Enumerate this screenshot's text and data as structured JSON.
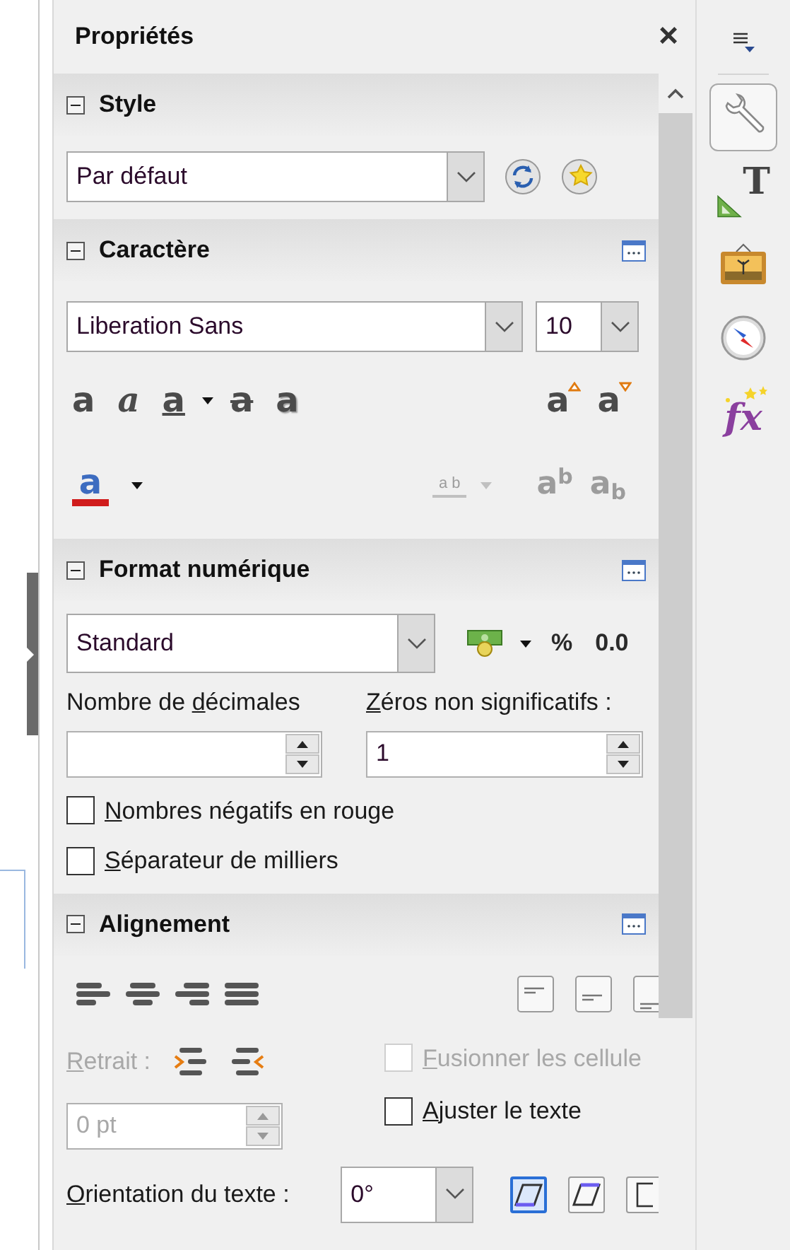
{
  "panel": {
    "title": "Propriétés",
    "close": "×"
  },
  "style_section": {
    "title": "Style",
    "expanded": true,
    "value": "Par défaut"
  },
  "character_section": {
    "title": "Caractère",
    "expanded": true,
    "font": "Liberation Sans",
    "size": "10",
    "format_buttons": [
      {
        "kind": "bold",
        "glyph": "a",
        "disabled": false
      },
      {
        "kind": "italic",
        "glyph": "a",
        "disabled": false
      },
      {
        "kind": "underline",
        "glyph": "a",
        "disabled": false
      },
      {
        "kind": "strike",
        "glyph": "a",
        "disabled": false
      },
      {
        "kind": "shadow",
        "glyph": "a",
        "disabled": false
      }
    ],
    "size_buttons": [
      {
        "kind": "grow",
        "glyph": "a",
        "disabled": false
      },
      {
        "kind": "shrink",
        "glyph": "a",
        "disabled": false
      }
    ],
    "color_button": {
      "glyph": "a",
      "color": "#d01c1c"
    },
    "spacing_button": {
      "glyph": "a b",
      "disabled": true
    },
    "script_buttons": [
      {
        "kind": "superscript",
        "glyph": "a",
        "mark": "b",
        "disabled": true
      },
      {
        "kind": "subscript",
        "glyph": "a",
        "mark": "b",
        "disabled": true
      }
    ]
  },
  "number_section": {
    "title": "Format numérique",
    "expanded": true,
    "format": "Standard",
    "buttons": [
      {
        "kind": "currency"
      },
      {
        "kind": "text",
        "glyph": "%"
      },
      {
        "kind": "text",
        "glyph": "0.0"
      }
    ],
    "decimals_label": {
      "pre": "Nombre de ",
      "key": "d",
      "post": "écimales"
    },
    "zeros_label": {
      "key": "Z",
      "post": "éros non significatifs :"
    },
    "zeros_value": "1",
    "checkboxes": [
      {
        "label": {
          "key": "N",
          "post": "ombres négatifs en rouge"
        },
        "checked": false,
        "disabled": false
      },
      {
        "label": {
          "key": "S",
          "post": "éparateur de milliers"
        },
        "checked": false,
        "disabled": false
      }
    ]
  },
  "alignment_section": {
    "title": "Alignement",
    "expanded": true,
    "horizontal": [
      {
        "kind": "left"
      },
      {
        "kind": "center"
      },
      {
        "kind": "right"
      },
      {
        "kind": "justify"
      }
    ],
    "vertical": [
      {
        "kind": "top"
      },
      {
        "kind": "middle"
      },
      {
        "kind": "bottom"
      }
    ],
    "indent_label": {
      "key": "R",
      "post": "etrait :"
    },
    "indent_disabled": true,
    "indent_value": "0 pt",
    "checkboxes": [
      {
        "label": {
          "key": "F",
          "post": "usionner les cellule"
        },
        "checked": false,
        "disabled": true
      },
      {
        "label": {
          "key": "A",
          "post": "juster le texte"
        },
        "checked": false,
        "disabled": false
      }
    ],
    "orientation_label": {
      "key": "O",
      "post": "rientation du texte :"
    },
    "orientation_value": "0°",
    "orientation_buttons": [
      {
        "kind": "bottom",
        "selected": true
      },
      {
        "kind": "top",
        "selected": false
      },
      {
        "kind": "stacked",
        "selected": false
      }
    ]
  },
  "tabs": [
    {
      "kind": "properties",
      "selected": true
    },
    {
      "kind": "styles",
      "glyph": "T",
      "selected": false
    },
    {
      "kind": "gallery",
      "selected": false
    },
    {
      "kind": "navigator",
      "selected": false
    },
    {
      "kind": "functions",
      "glyph": "fx",
      "selected": false
    }
  ]
}
